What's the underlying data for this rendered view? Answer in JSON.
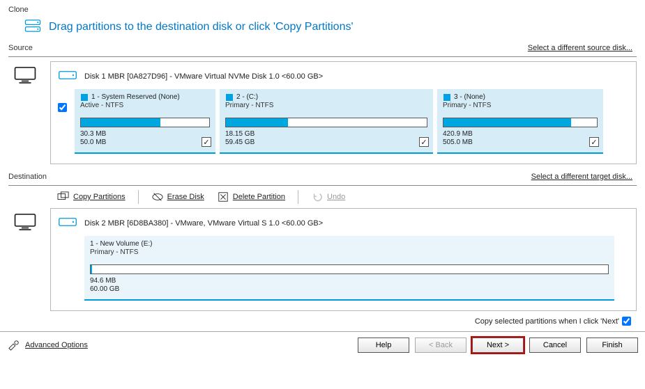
{
  "header": {
    "clone_label": "Clone",
    "title": "Drag partitions to the destination disk or click 'Copy Partitions'"
  },
  "source": {
    "label": "Source",
    "select_link": "Select a different source disk...",
    "disk_title": "Disk 1 MBR [0A827D96] - VMware Virtual NVMe Disk 1.0   <60.00 GB>",
    "partitions": [
      {
        "head": "1 - System Reserved (None)",
        "sub": "Active - NTFS",
        "used": "30.3 MB",
        "total": "50.0 MB",
        "fill": 62
      },
      {
        "head": "2 -  (C:)",
        "sub": "Primary - NTFS",
        "used": "18.15 GB",
        "total": "59.45 GB",
        "fill": 31
      },
      {
        "head": "3 -  (None)",
        "sub": "Primary - NTFS",
        "used": "420.9 MB",
        "total": "505.0 MB",
        "fill": 83
      }
    ]
  },
  "destination": {
    "label": "Destination",
    "select_link": "Select a different target disk...",
    "toolbar": {
      "copy": "Copy Partitions",
      "erase": "Erase Disk",
      "delete": "Delete Partition",
      "undo": "Undo"
    },
    "disk_title": "Disk 2 MBR [6D8BA380] - VMware,  VMware Virtual S 1.0   <60.00 GB>",
    "partition": {
      "head": "1 - New Volume (E:)",
      "sub": "Primary - NTFS",
      "used": "94.6 MB",
      "total": "60.00 GB",
      "fill": 0
    }
  },
  "copy_option": "Copy selected partitions when I click 'Next'",
  "footer": {
    "advanced": "Advanced Options",
    "buttons": {
      "help": "Help",
      "back": "< Back",
      "next": "Next >",
      "cancel": "Cancel",
      "finish": "Finish"
    }
  }
}
